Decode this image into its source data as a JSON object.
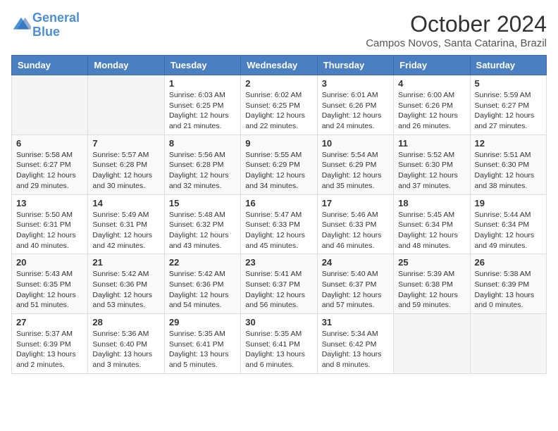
{
  "header": {
    "logo_line1": "General",
    "logo_line2": "Blue",
    "month_year": "October 2024",
    "location": "Campos Novos, Santa Catarina, Brazil"
  },
  "days_of_week": [
    "Sunday",
    "Monday",
    "Tuesday",
    "Wednesday",
    "Thursday",
    "Friday",
    "Saturday"
  ],
  "weeks": [
    [
      {
        "day": "",
        "info": ""
      },
      {
        "day": "",
        "info": ""
      },
      {
        "day": "1",
        "info": "Sunrise: 6:03 AM\nSunset: 6:25 PM\nDaylight: 12 hours and 21 minutes."
      },
      {
        "day": "2",
        "info": "Sunrise: 6:02 AM\nSunset: 6:25 PM\nDaylight: 12 hours and 22 minutes."
      },
      {
        "day": "3",
        "info": "Sunrise: 6:01 AM\nSunset: 6:26 PM\nDaylight: 12 hours and 24 minutes."
      },
      {
        "day": "4",
        "info": "Sunrise: 6:00 AM\nSunset: 6:26 PM\nDaylight: 12 hours and 26 minutes."
      },
      {
        "day": "5",
        "info": "Sunrise: 5:59 AM\nSunset: 6:27 PM\nDaylight: 12 hours and 27 minutes."
      }
    ],
    [
      {
        "day": "6",
        "info": "Sunrise: 5:58 AM\nSunset: 6:27 PM\nDaylight: 12 hours and 29 minutes."
      },
      {
        "day": "7",
        "info": "Sunrise: 5:57 AM\nSunset: 6:28 PM\nDaylight: 12 hours and 30 minutes."
      },
      {
        "day": "8",
        "info": "Sunrise: 5:56 AM\nSunset: 6:28 PM\nDaylight: 12 hours and 32 minutes."
      },
      {
        "day": "9",
        "info": "Sunrise: 5:55 AM\nSunset: 6:29 PM\nDaylight: 12 hours and 34 minutes."
      },
      {
        "day": "10",
        "info": "Sunrise: 5:54 AM\nSunset: 6:29 PM\nDaylight: 12 hours and 35 minutes."
      },
      {
        "day": "11",
        "info": "Sunrise: 5:52 AM\nSunset: 6:30 PM\nDaylight: 12 hours and 37 minutes."
      },
      {
        "day": "12",
        "info": "Sunrise: 5:51 AM\nSunset: 6:30 PM\nDaylight: 12 hours and 38 minutes."
      }
    ],
    [
      {
        "day": "13",
        "info": "Sunrise: 5:50 AM\nSunset: 6:31 PM\nDaylight: 12 hours and 40 minutes."
      },
      {
        "day": "14",
        "info": "Sunrise: 5:49 AM\nSunset: 6:31 PM\nDaylight: 12 hours and 42 minutes."
      },
      {
        "day": "15",
        "info": "Sunrise: 5:48 AM\nSunset: 6:32 PM\nDaylight: 12 hours and 43 minutes."
      },
      {
        "day": "16",
        "info": "Sunrise: 5:47 AM\nSunset: 6:33 PM\nDaylight: 12 hours and 45 minutes."
      },
      {
        "day": "17",
        "info": "Sunrise: 5:46 AM\nSunset: 6:33 PM\nDaylight: 12 hours and 46 minutes."
      },
      {
        "day": "18",
        "info": "Sunrise: 5:45 AM\nSunset: 6:34 PM\nDaylight: 12 hours and 48 minutes."
      },
      {
        "day": "19",
        "info": "Sunrise: 5:44 AM\nSunset: 6:34 PM\nDaylight: 12 hours and 49 minutes."
      }
    ],
    [
      {
        "day": "20",
        "info": "Sunrise: 5:43 AM\nSunset: 6:35 PM\nDaylight: 12 hours and 51 minutes."
      },
      {
        "day": "21",
        "info": "Sunrise: 5:42 AM\nSunset: 6:36 PM\nDaylight: 12 hours and 53 minutes."
      },
      {
        "day": "22",
        "info": "Sunrise: 5:42 AM\nSunset: 6:36 PM\nDaylight: 12 hours and 54 minutes."
      },
      {
        "day": "23",
        "info": "Sunrise: 5:41 AM\nSunset: 6:37 PM\nDaylight: 12 hours and 56 minutes."
      },
      {
        "day": "24",
        "info": "Sunrise: 5:40 AM\nSunset: 6:37 PM\nDaylight: 12 hours and 57 minutes."
      },
      {
        "day": "25",
        "info": "Sunrise: 5:39 AM\nSunset: 6:38 PM\nDaylight: 12 hours and 59 minutes."
      },
      {
        "day": "26",
        "info": "Sunrise: 5:38 AM\nSunset: 6:39 PM\nDaylight: 13 hours and 0 minutes."
      }
    ],
    [
      {
        "day": "27",
        "info": "Sunrise: 5:37 AM\nSunset: 6:39 PM\nDaylight: 13 hours and 2 minutes."
      },
      {
        "day": "28",
        "info": "Sunrise: 5:36 AM\nSunset: 6:40 PM\nDaylight: 13 hours and 3 minutes."
      },
      {
        "day": "29",
        "info": "Sunrise: 5:35 AM\nSunset: 6:41 PM\nDaylight: 13 hours and 5 minutes."
      },
      {
        "day": "30",
        "info": "Sunrise: 5:35 AM\nSunset: 6:41 PM\nDaylight: 13 hours and 6 minutes."
      },
      {
        "day": "31",
        "info": "Sunrise: 5:34 AM\nSunset: 6:42 PM\nDaylight: 13 hours and 8 minutes."
      },
      {
        "day": "",
        "info": ""
      },
      {
        "day": "",
        "info": ""
      }
    ]
  ]
}
